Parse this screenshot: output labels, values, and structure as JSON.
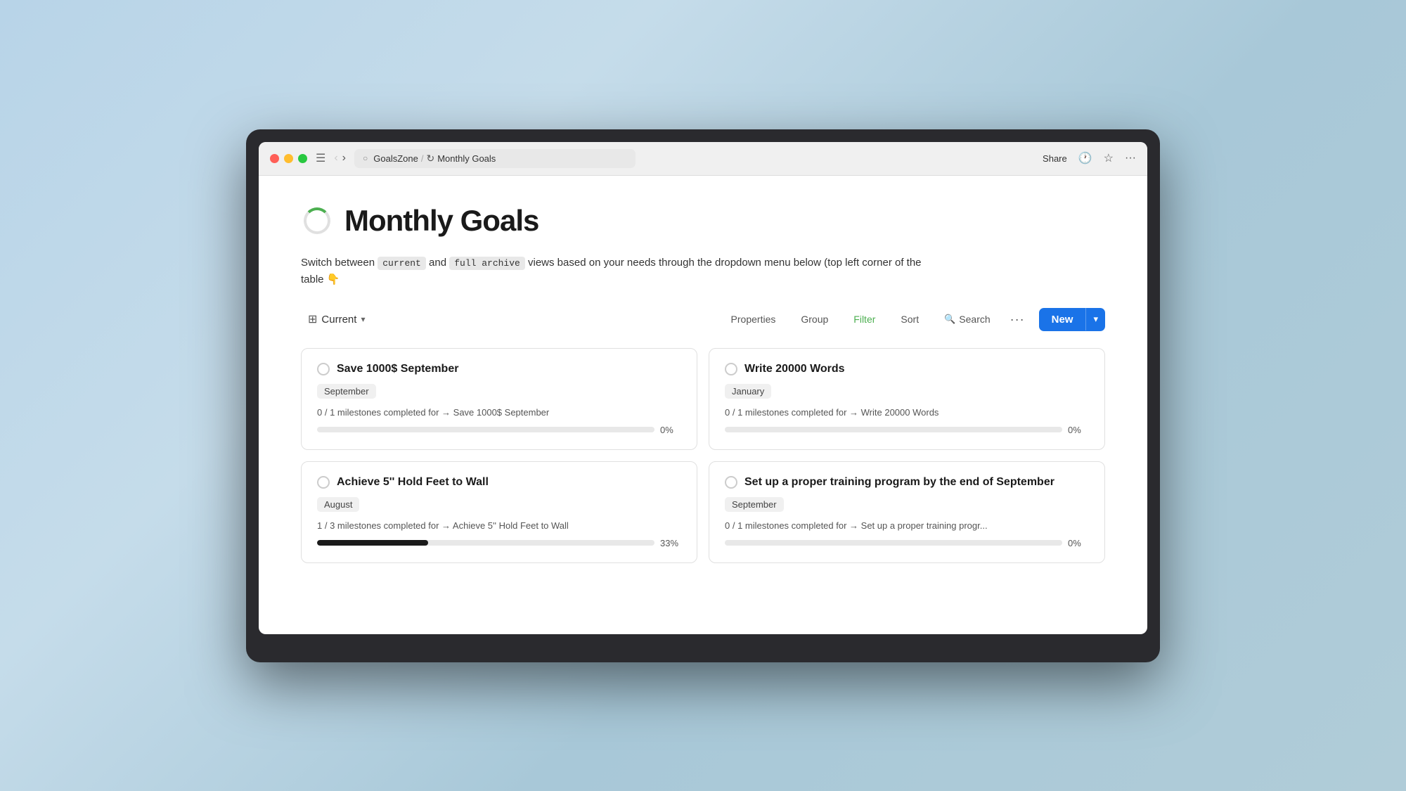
{
  "browser": {
    "address": {
      "site": "GoalsZone",
      "separator": "/",
      "page": "Monthly Goals"
    },
    "actions": {
      "share": "Share"
    }
  },
  "page": {
    "title": "Monthly Goals",
    "description_parts": {
      "before": "Switch between",
      "tag1": "current",
      "middle": "and",
      "tag2": "full archive",
      "after": "views based on your needs through the dropdown menu below (top left corner of the table 👇"
    }
  },
  "toolbar": {
    "view_label": "Current",
    "properties_label": "Properties",
    "group_label": "Group",
    "filter_label": "Filter",
    "sort_label": "Sort",
    "search_label": "Search",
    "new_label": "New"
  },
  "goals": [
    {
      "id": 1,
      "title": "Save 1000$ September",
      "tag": "September",
      "milestone_text": "0 / 1 milestones completed for → Save 1000$ September",
      "progress_pct": 0,
      "progress_label": "0%"
    },
    {
      "id": 2,
      "title": "Write 20000 Words",
      "tag": "January",
      "milestone_text": "0 / 1 milestones completed for → Write 20000 Words",
      "progress_pct": 0,
      "progress_label": "0%"
    },
    {
      "id": 3,
      "title": "Achieve 5'' Hold Feet to Wall",
      "tag": "August",
      "milestone_text": "1 / 3 milestones completed for → Achieve 5'' Hold Feet to Wall",
      "progress_pct": 33,
      "progress_label": "33%"
    },
    {
      "id": 4,
      "title": "Set up a proper training program by the end of September",
      "tag": "September",
      "milestone_text": "0 / 1 milestones completed for → Set up a proper training progr...",
      "progress_pct": 0,
      "progress_label": "0%"
    }
  ]
}
